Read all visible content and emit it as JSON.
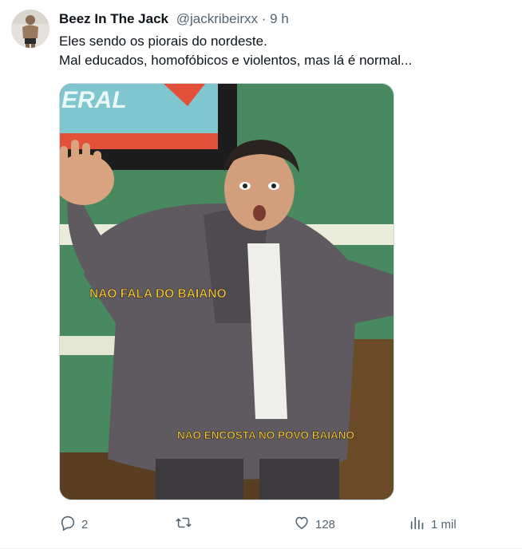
{
  "tweet": {
    "author": {
      "display_name": "Beez In The Jack",
      "handle": "@jackribeirxx",
      "separator": "·",
      "time": "9 h"
    },
    "text_lines": [
      "Eles sendo os piorais do nordeste.",
      "Mal educados, homofóbicos e violentos, mas lá é normal..."
    ],
    "media": {
      "caption_top": "NAO FALA DO BAIANO",
      "caption_bottom": "NAO ENCOSTA NO POVO BAIANO",
      "tv_sign_text": "ERAL"
    },
    "actions": {
      "reply": {
        "icon": "reply-icon",
        "count": "2"
      },
      "retweet": {
        "icon": "retweet-icon",
        "count": ""
      },
      "like": {
        "icon": "heart-icon",
        "count": "128"
      },
      "views": {
        "icon": "views-icon",
        "count": "1 mil"
      }
    }
  },
  "colors": {
    "text_primary": "#0f1419",
    "text_secondary": "#536471",
    "caption_yellow": "#f5c542",
    "studio_green": "#4f8f64"
  }
}
